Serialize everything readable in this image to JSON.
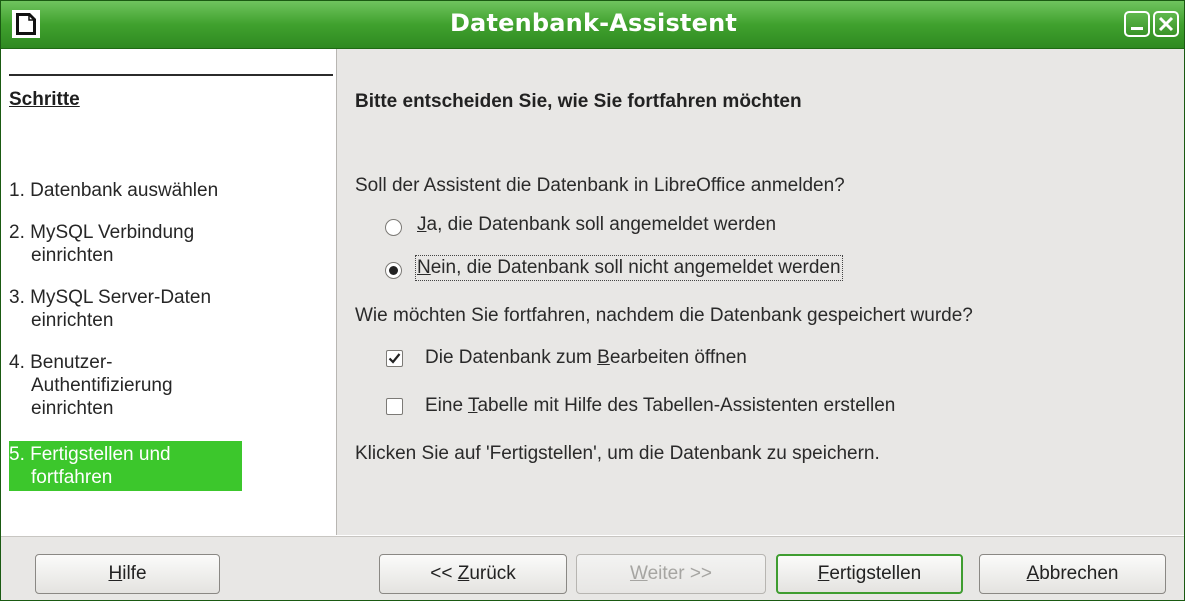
{
  "window": {
    "title": "Datenbank-Assistent",
    "accent": "#3cc72c",
    "titlebar_color": "#40a12e"
  },
  "steps": {
    "heading": "Schritte",
    "items": [
      {
        "label": "1. Datenbank auswählen"
      },
      {
        "label": "2. MySQL Verbindung einrichten"
      },
      {
        "label": "3. MySQL Server-Daten einrichten"
      },
      {
        "label": "4. Benutzer-Authentifizierung einrichten"
      },
      {
        "label": "5. Fertigstellen und fortfahren",
        "active": true
      }
    ]
  },
  "content": {
    "title": "Bitte entscheiden Sie, wie Sie fortfahren möchten",
    "register_question": "Soll der Assistent die Datenbank in LibreOffice anmelden?",
    "radio_yes": {
      "accel": "J",
      "rest": "a, die Datenbank soll angemeldet werden",
      "selected": false
    },
    "radio_no": {
      "accel": "N",
      "rest": "ein, die Datenbank soll nicht angemeldet werden",
      "selected": true
    },
    "continue_question": "Wie möchten Sie fortfahren, nachdem die Datenbank gespeichert wurde?",
    "check_open": {
      "pre": "Die Datenbank zum ",
      "accel": "B",
      "rest": "earbeiten öffnen",
      "checked": true
    },
    "check_table": {
      "pre": "Eine ",
      "accel": "T",
      "rest": "abelle mit Hilfe des Tabellen-Assistenten erstellen",
      "checked": false
    },
    "finish_hint": "Klicken Sie auf 'Fertigstellen', um die Datenbank zu speichern."
  },
  "buttons": {
    "help": {
      "accel": "H",
      "rest": "ilfe"
    },
    "back": {
      "pre": "<< ",
      "accel": "Z",
      "rest": "urück"
    },
    "next": {
      "accel": "W",
      "rest": "eiter >>",
      "disabled": true
    },
    "finish": {
      "accel": "F",
      "rest": "ertigstellen",
      "default": true
    },
    "cancel": {
      "accel": "A",
      "rest": "bbrechen"
    }
  }
}
